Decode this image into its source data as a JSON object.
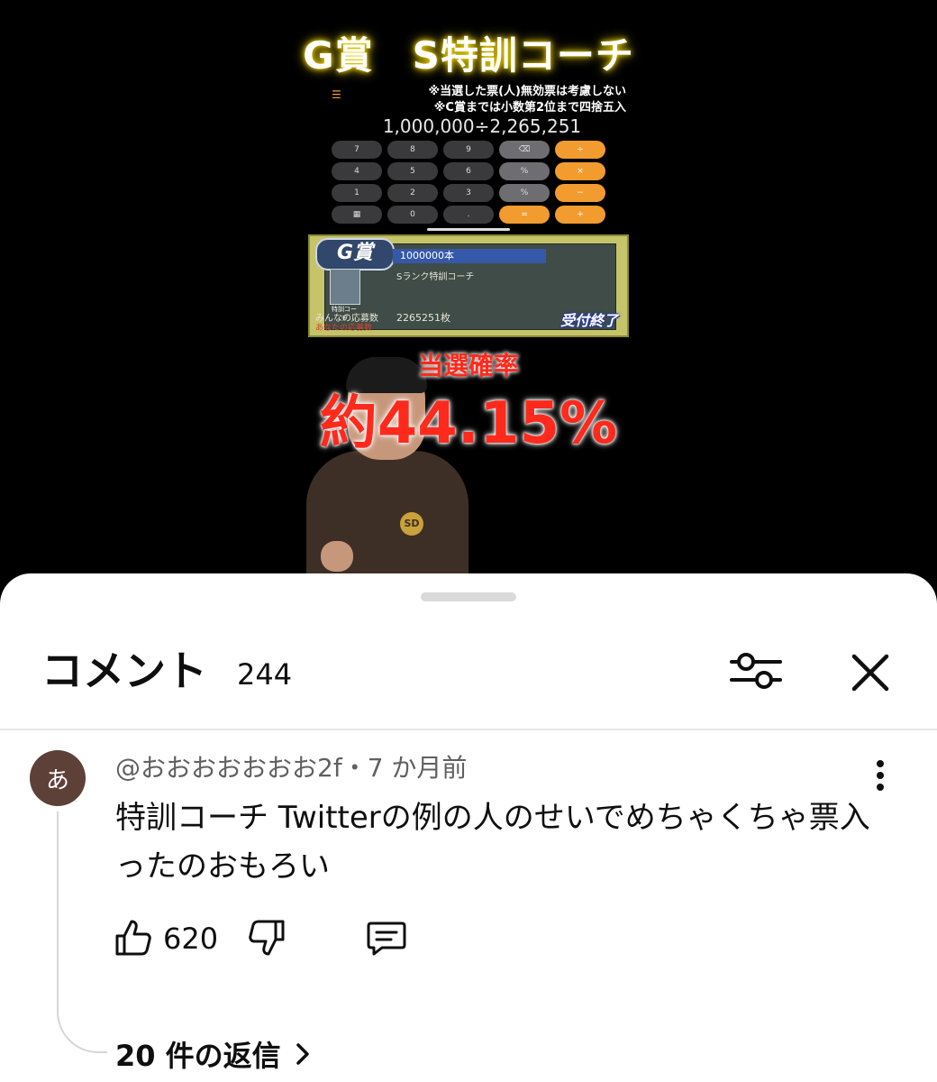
{
  "video": {
    "title": "G賞　S特訓コーチ",
    "note_line1": "※当選した票(人)無効票は考慮しない",
    "note_line2": "※C賞までは小数第2位まで四捨五入",
    "calc_expression": "1,000,000÷2,265,251",
    "calc_keys": [
      "7",
      "8",
      "9",
      "⌫",
      "÷",
      "4",
      "5",
      "6",
      "%",
      "×",
      "1",
      "2",
      "3",
      "%",
      "−",
      "▦",
      "0",
      ".",
      "=",
      "+"
    ],
    "card": {
      "badge": "G賞",
      "count": "1000000本",
      "name": "Sランク特訓コーチ",
      "thumb_label": "特訓コーチ",
      "applicants_label": "みんなの応募数",
      "applicants_value": "2265251枚",
      "mine_label": "あなたの応募数",
      "status": "受付終了"
    },
    "prob_label": "当選確率",
    "prob_value": "約44.15%",
    "shirt_logo": "SD"
  },
  "comments_panel": {
    "title": "コメント",
    "count": "244",
    "comment": {
      "avatar_letter": "あ",
      "author": "@おおおおおおお2f",
      "separator": "・",
      "time": "7 か月前",
      "text": "特訓コーチ Twitterの例の人のせいでめちゃくちゃ票入ったのおもろい",
      "likes": "620",
      "replies_label": "20 件の返信"
    }
  },
  "icons": {
    "filter": "sliders-icon",
    "close": "close-icon",
    "more": "more-vert-icon",
    "like": "thumb-up-icon",
    "dislike": "thumb-down-icon",
    "reply": "comment-icon",
    "chevron": "chevron-right-icon"
  },
  "colors": {
    "sheet_bg": "#ffffff",
    "avatar_bg": "#5d4037",
    "video_bg": "#000000",
    "prob_red": "#ff2a1c",
    "calc_orange": "#f29b2f"
  }
}
